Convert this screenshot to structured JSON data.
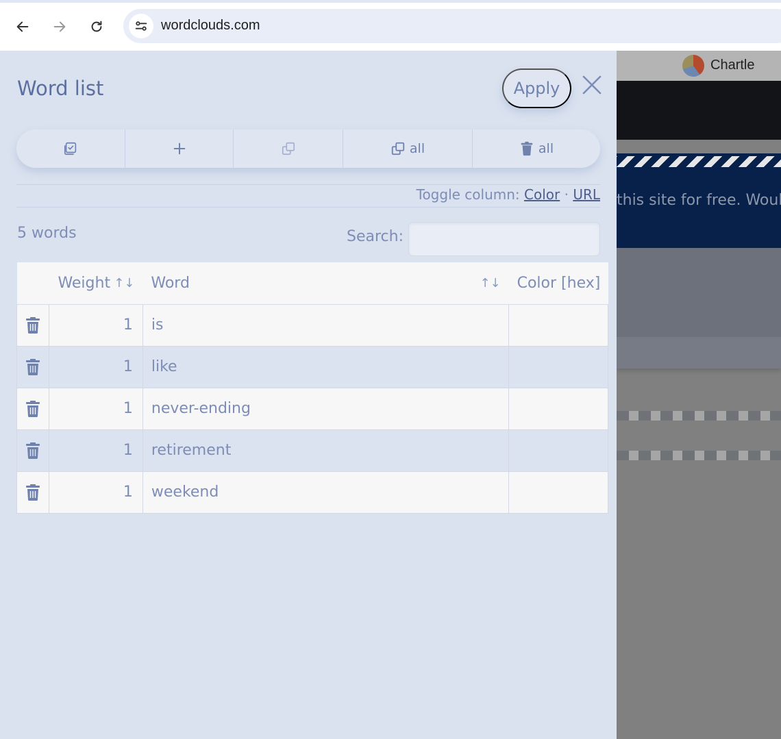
{
  "browser": {
    "url": "wordclouds.com"
  },
  "background_page": {
    "brand": "Chartle",
    "banner_text": "this site for free. Woul"
  },
  "panel": {
    "title": "Word list",
    "apply_label": "Apply",
    "toolbar": {
      "copy_all_label": "all",
      "delete_all_label": "all"
    },
    "toggle": {
      "prefix": "Toggle column:",
      "color_link": "Color",
      "separator": "·",
      "url_link": "URL"
    },
    "word_count": "5 words",
    "search": {
      "label": "Search:",
      "value": "",
      "placeholder": ""
    },
    "table": {
      "headers": {
        "weight": "Weight",
        "word": "Word",
        "color": "Color [hex]",
        "sort_symbol": "↑↓"
      },
      "rows": [
        {
          "weight": "1",
          "word": "is",
          "color": ""
        },
        {
          "weight": "1",
          "word": "like",
          "color": ""
        },
        {
          "weight": "1",
          "word": "never-ending",
          "color": ""
        },
        {
          "weight": "1",
          "word": "retirement",
          "color": ""
        },
        {
          "weight": "1",
          "word": "weekend",
          "color": ""
        }
      ]
    }
  },
  "colors": {
    "panel_bg": "#dae2ef",
    "accent": "#6f81ad",
    "row_alt": "#dbe3f0",
    "row": "#f7f7f8"
  }
}
